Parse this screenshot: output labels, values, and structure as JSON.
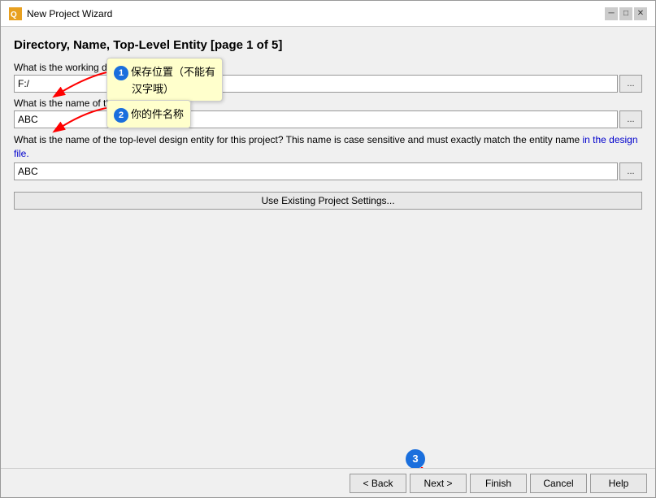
{
  "window": {
    "title": "New Project Wizard",
    "close_label": "✕"
  },
  "page": {
    "title": "Directory, Name, Top-Level Entity [page 1 of 5]"
  },
  "form": {
    "working_dir_label": "What is the working directory for this project?",
    "working_dir_value": "F:/",
    "browse1_label": "...",
    "project_name_label": "What is the name of this project?",
    "project_name_value": "ABC",
    "browse2_label": "...",
    "top_entity_label_pre": "What is the name of the top-level design entity for this project? This name is case sensitive and must exactly match the entity name",
    "top_entity_label_blue": " in the design file.",
    "top_entity_value": "ABC",
    "browse3_label": "...",
    "use_existing_label": "Use Existing Project Settings..."
  },
  "annotations": {
    "bubble1_line1": "保存位置（不能有",
    "bubble1_circle": "1",
    "bubble1_line2": "汉字哦）",
    "bubble2_line1": "你的",
    "bubble2_circle": "2",
    "bubble2_line2": "件名称",
    "circle3": "3"
  },
  "bottom_bar": {
    "back_label": "< Back",
    "next_label": "Next >",
    "finish_label": "Finish",
    "cancel_label": "Cancel",
    "help_label": "Help"
  }
}
